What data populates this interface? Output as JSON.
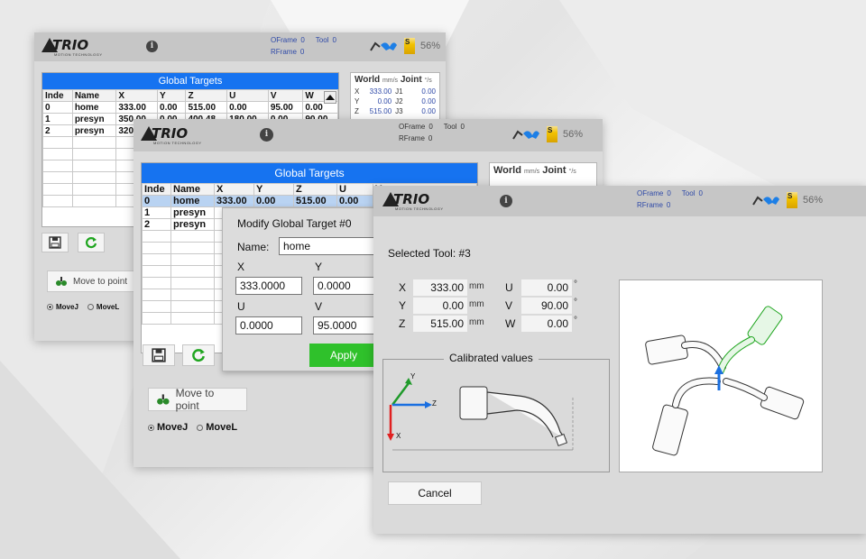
{
  "brand": {
    "name": "TRIO",
    "tagline": "MOTION TECHNOLOGY"
  },
  "status": {
    "oframe_label": "OFrame",
    "oframe_value": "0",
    "tool_label": "Tool",
    "tool_value": "0",
    "rframe_label": "RFrame",
    "rframe_value": "0",
    "speed_icon_label": "S",
    "speed_percent": "56%",
    "info_glyph": "i"
  },
  "targets": {
    "title": "Global Targets",
    "columns": [
      "Inde",
      "Name",
      "X",
      "Y",
      "Z",
      "U",
      "V",
      "W"
    ],
    "rows": [
      [
        "0",
        "home",
        "333.00",
        "0.00",
        "515.00",
        "0.00",
        "95.00",
        "0.00"
      ],
      [
        "1",
        "presyn",
        "350.00",
        "0.00",
        "400.48",
        "180.00",
        "0.00",
        "90.00"
      ],
      [
        "2",
        "presyn",
        "320.00",
        "",
        "",
        "",
        "",
        ""
      ]
    ]
  },
  "position_card": {
    "world_label": "World",
    "world_unit": "mm/s",
    "joint_label": "Joint",
    "joint_unit": "°/s",
    "rows": [
      {
        "axis": "X",
        "value": "333.00",
        "joint": "J1",
        "jvalue": "0.00"
      },
      {
        "axis": "Y",
        "value": "0.00",
        "joint": "J2",
        "jvalue": "0.00"
      },
      {
        "axis": "Z",
        "value": "515.00",
        "joint": "J3",
        "jvalue": "0.00"
      }
    ]
  },
  "actions": {
    "move_to_point": "Move to point",
    "movej": "MoveJ",
    "movel": "MoveL"
  },
  "modify_dialog": {
    "title": "Modify Global Target #0",
    "name_label": "Name:",
    "name_value": "home",
    "x_label": "X",
    "x_value": "333.0000",
    "y_label": "Y",
    "y_value": "0.0000",
    "u_label": "U",
    "u_value": "0.0000",
    "v_label": "V",
    "v_value": "95.0000",
    "apply": "Apply"
  },
  "tool_panel": {
    "selected_tool": "Selected Tool: #3",
    "values": [
      {
        "axis": "X",
        "value": "333.00",
        "unit": "mm"
      },
      {
        "axis": "Y",
        "value": "0.00",
        "unit": "mm"
      },
      {
        "axis": "Z",
        "value": "515.00",
        "unit": "mm"
      }
    ],
    "rot_values": [
      {
        "axis": "U",
        "value": "0.00",
        "unit": "°"
      },
      {
        "axis": "V",
        "value": "90.00",
        "unit": "°"
      },
      {
        "axis": "W",
        "value": "0.00",
        "unit": "°"
      }
    ],
    "calibrated_title": "Calibrated values",
    "axis_y": "Y",
    "axis_z": "Z",
    "axis_x": "X",
    "cancel": "Cancel"
  },
  "colors": {
    "accent_blue": "#1673f0",
    "apply_green": "#2fc12b",
    "frame_text": "#2f4aa8",
    "panel_bg": "#dadada",
    "topbar_bg": "#c6c6c6"
  }
}
